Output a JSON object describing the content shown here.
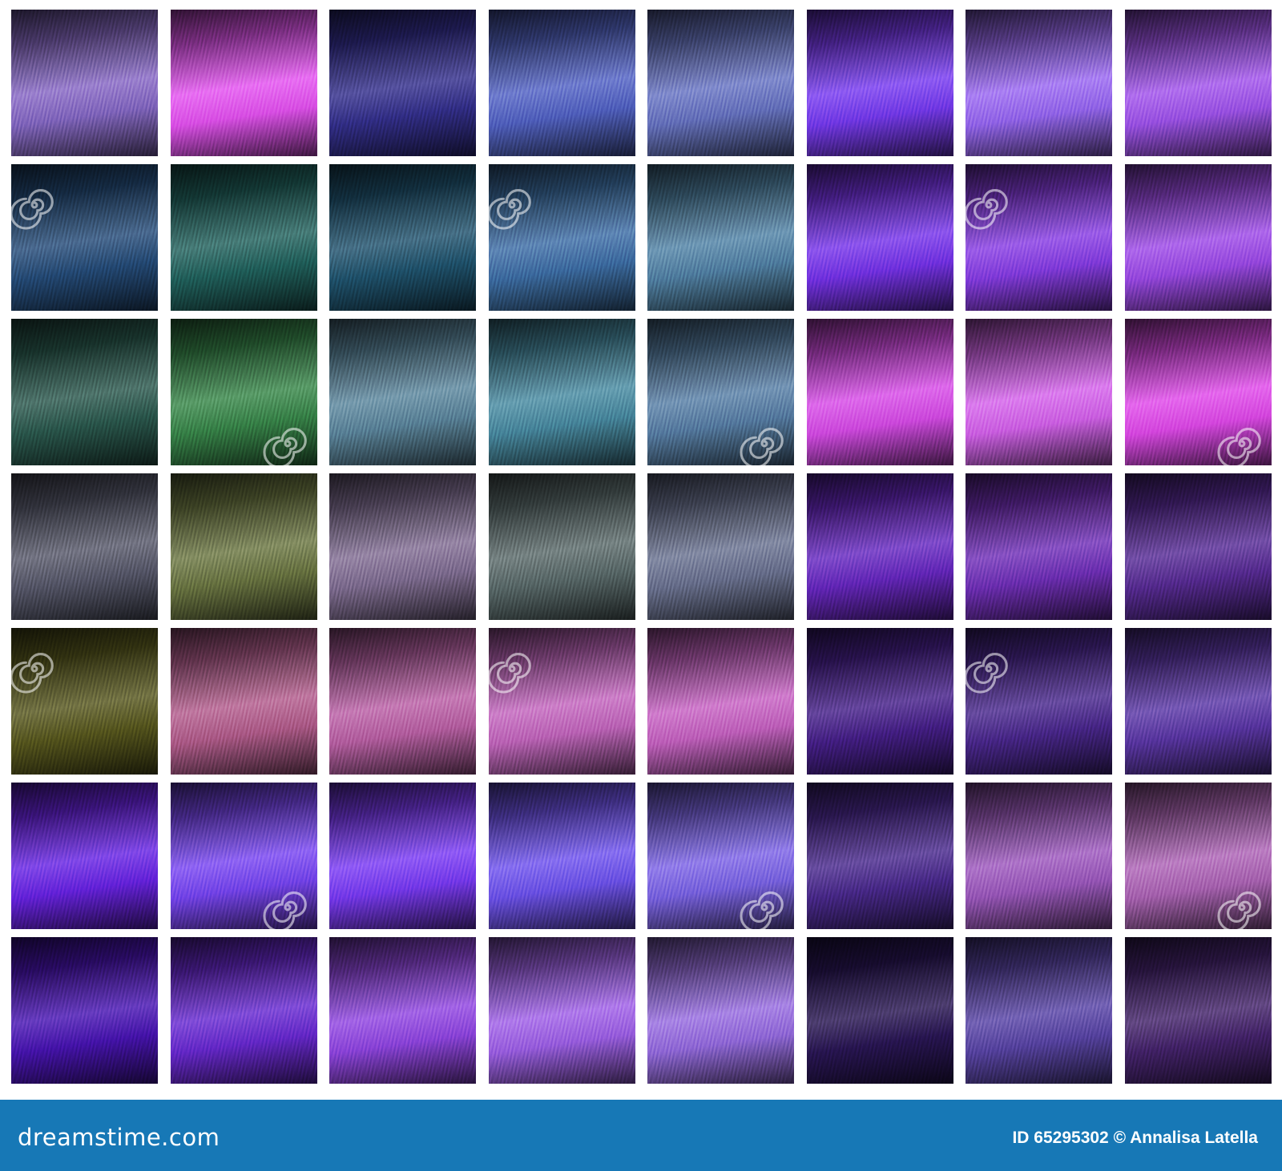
{
  "palette": {
    "rows": [
      [
        "#8a6cc6",
        "#e455f0",
        "#35308f",
        "#5566c6",
        "#6b78c4",
        "#7b3cf0",
        "#9c6bf2",
        "#a356ec"
      ],
      [
        "#264e7c",
        "#226560",
        "#215672",
        "#3f72a8",
        "#5486a8",
        "#7a34ea",
        "#8b3ee4",
        "#a04ce8"
      ],
      [
        "#2c5c50",
        "#3a8a4c",
        "#5f8aa0",
        "#4b8ea4",
        "#5b82a8",
        "#d84ee8",
        "#d666ec",
        "#e04cea"
      ],
      [
        "#5a5c6e",
        "#6f7a44",
        "#857296",
        "#5e6e6e",
        "#6e7694",
        "#6a28c2",
        "#7430ba",
        "#5a2c98"
      ],
      [
        "#5a5a1e",
        "#b56090",
        "#bc64a8",
        "#c56ac0",
        "#c866c4",
        "#48208c",
        "#4c2890",
        "#5e38a8"
      ],
      [
        "#6c24e4",
        "#7c48f2",
        "#7e3cf4",
        "#7356ee",
        "#8068e6",
        "#4c2a90",
        "#a05cc0",
        "#b068b8"
      ],
      [
        "#4a14b4",
        "#6c2ad2",
        "#9448e2",
        "#a264e8",
        "#9a70e0",
        "#2a1656",
        "#5c46a8",
        "#46246e"
      ]
    ]
  },
  "footer": {
    "logo": "dreamstime.com",
    "credit": "ID 65295302 © Annalisa Latella"
  },
  "watermark": {
    "text": "dreamstime"
  },
  "colors": {
    "footer_bg": "#1778b6",
    "background": "#ffffff"
  }
}
